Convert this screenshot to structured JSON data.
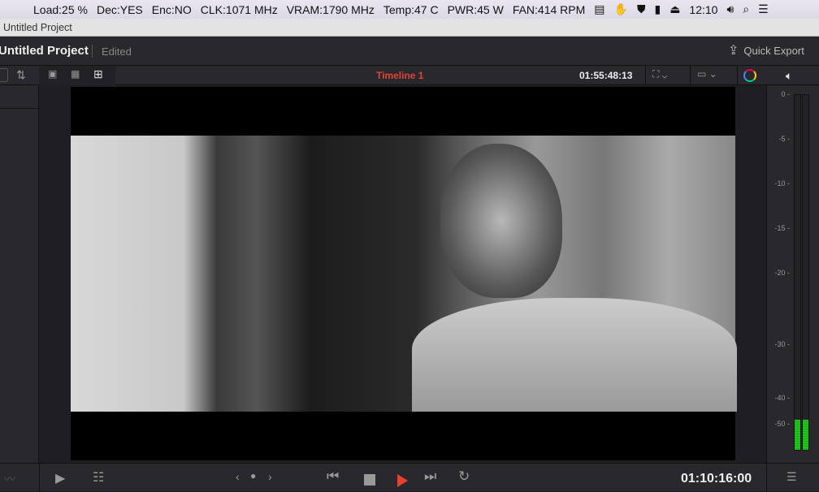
{
  "menubar": {
    "items": [
      "Load:25 %",
      "Dec:YES",
      "Enc:NO",
      "CLK:1071  MHz",
      "VRAM:1790 MHz",
      "Temp:47 C",
      "PWR:45 W",
      "FAN:414 RPM"
    ],
    "clock": "12:10"
  },
  "window_title": "Untitled Project",
  "header": {
    "project": "Untitled Project",
    "status": "Edited",
    "quick_export": "Quick Export"
  },
  "toolbar": {
    "timeline": "Timeline 1",
    "timecode": "01:55:48:13"
  },
  "meters": {
    "ticks": [
      "0 -",
      "-5 -",
      "-10 -",
      "-15 -",
      "-20 -",
      "-30 -",
      "-40 -",
      "-50 -"
    ],
    "level_left": 0.085,
    "level_right": 0.085,
    "color": "#22c41e"
  },
  "transport": {
    "timecode": "01:10:16:00",
    "play_color": "#e8412f"
  }
}
